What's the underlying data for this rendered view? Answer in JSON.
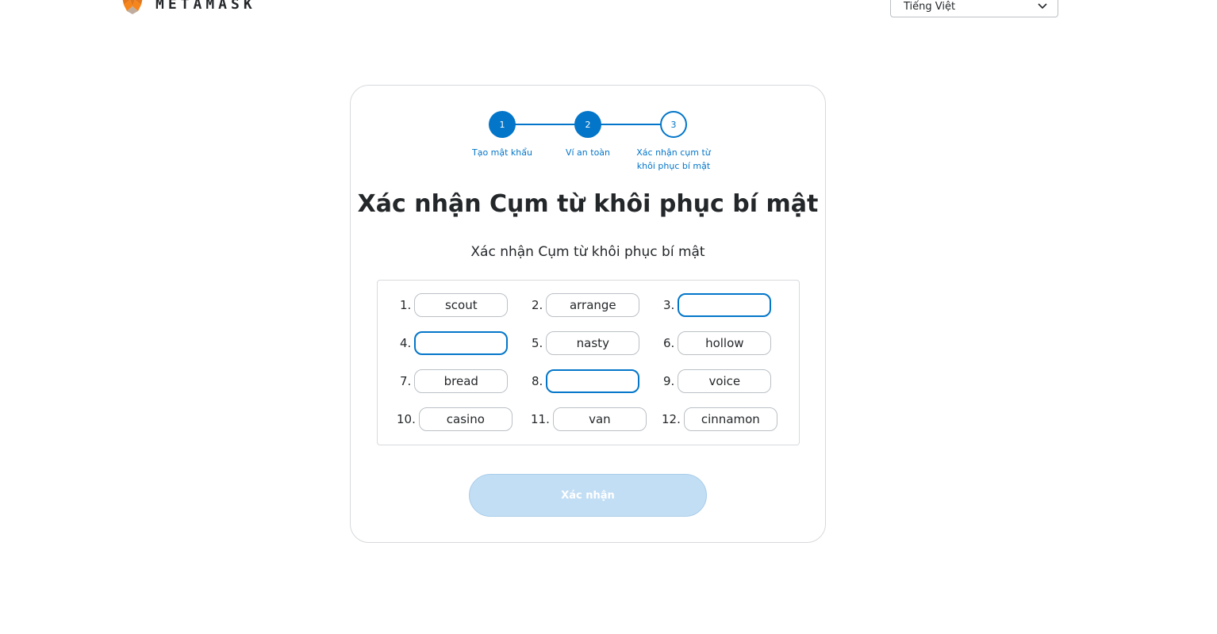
{
  "header": {
    "logo_text": "METAMASK",
    "language": "Tiếng Việt"
  },
  "stepper": {
    "steps": [
      {
        "number": "1",
        "label": "Tạo mật khẩu",
        "state": "done"
      },
      {
        "number": "2",
        "label": "Ví an toàn",
        "state": "done"
      },
      {
        "number": "3",
        "label_line1": "Xác nhận cụm từ",
        "label_line2": "khôi phục bí mật",
        "state": "current"
      }
    ]
  },
  "main": {
    "title": "Xác nhận Cụm từ khôi phục bí mật",
    "subtitle": "Xác nhận Cụm từ khôi phục bí mật",
    "confirm_label": "Xác nhận"
  },
  "words": [
    {
      "num": "1.",
      "value": "scout"
    },
    {
      "num": "2.",
      "value": "arrange"
    },
    {
      "num": "3.",
      "value": ""
    },
    {
      "num": "4.",
      "value": ""
    },
    {
      "num": "5.",
      "value": "nasty"
    },
    {
      "num": "6.",
      "value": "hollow"
    },
    {
      "num": "7.",
      "value": "bread"
    },
    {
      "num": "8.",
      "value": ""
    },
    {
      "num": "9.",
      "value": "voice"
    },
    {
      "num": "10.",
      "value": "casino"
    },
    {
      "num": "11.",
      "value": "van"
    },
    {
      "num": "12.",
      "value": "cinnamon"
    }
  ],
  "colors": {
    "accent": "#0376c9",
    "button_disabled": "#c2def4",
    "fox_orange": "#e2761b"
  }
}
